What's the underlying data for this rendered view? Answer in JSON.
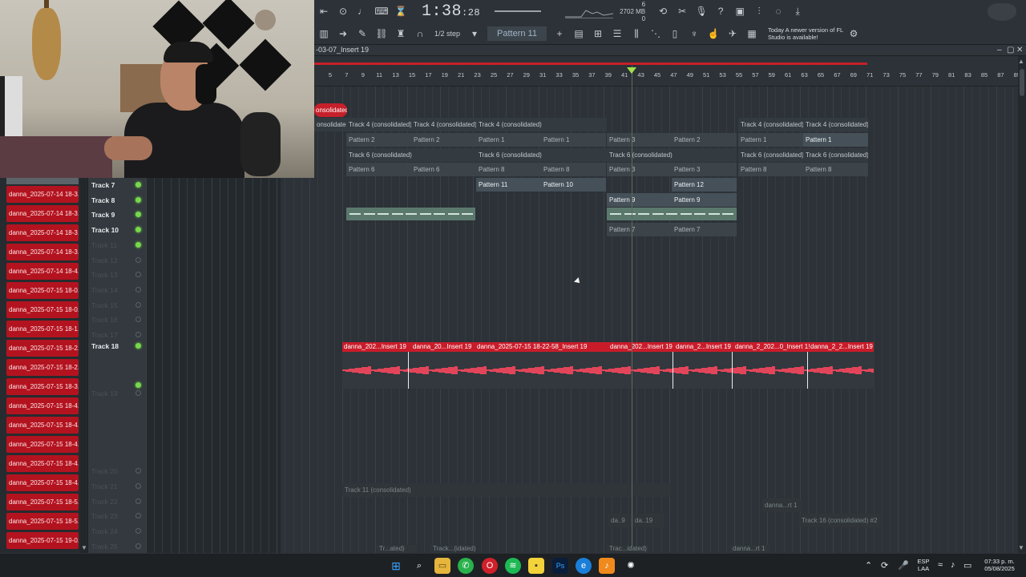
{
  "toolbar": {
    "time_main": "1:38",
    "time_small": ":28",
    "cpu_line1": "6",
    "cpu_line2": "2702 MB",
    "cpu_line3": "0",
    "snap_label": "1/2 step",
    "pattern_label": "Pattern 11",
    "notice_prefix": "Today",
    "notice_text": "A newer version of FL Studio is available!",
    "icons": [
      "record-icon",
      "metronome-icon",
      "typing-keyboard-icon",
      "wait-icon",
      "countdown-icon",
      "undo-icon",
      "cut-icon",
      "info-icon",
      "save-icon",
      "mixer-icon",
      "browser-icon",
      "download-icon"
    ]
  },
  "playlist": {
    "title": "-03-07_Insert 19",
    "timeline_numbers": [
      "5",
      "7",
      "9",
      "11",
      "13",
      "15",
      "17",
      "19",
      "21",
      "23",
      "25",
      "27",
      "29",
      "31",
      "33",
      "35",
      "37",
      "39",
      "41",
      "43",
      "45",
      "47",
      "49",
      "51",
      "53",
      "55",
      "57",
      "59",
      "61",
      "63",
      "65",
      "67",
      "69",
      "71",
      "73",
      "75",
      "77",
      "79",
      "81",
      "83",
      "85",
      "87",
      "89"
    ]
  },
  "browser": {
    "top_item": "",
    "items": [
      "danna_2025-07-14 18-3...",
      "danna_2025-07-14 18-3...",
      "danna_2025-07-14 18-3...",
      "danna_2025-07-14 18-3...",
      "danna_2025-07-14 18-4...",
      "danna_2025-07-15 18-0...",
      "danna_2025-07-15 18-0...",
      "danna_2025-07-15 18-1...",
      "danna_2025-07-15 18-2...",
      "danna_2025-07-15 18-2...",
      "danna_2025-07-15 18-3...",
      "danna_2025-07-15 18-4...",
      "danna_2025-07-15 18-4...",
      "danna_2025-07-15 18-4...",
      "danna_2025-07-15 18-4...",
      "danna_2025-07-15 18-4...",
      "danna_2025-07-15 18-5...",
      "danna_2025-07-15 18-5...",
      "danna_2025-07-15 19-0..."
    ]
  },
  "tracks": [
    {
      "name": "Track 7",
      "state": "active"
    },
    {
      "name": "Track 8",
      "state": "active"
    },
    {
      "name": "Track 9",
      "state": "active"
    },
    {
      "name": "Track 10",
      "state": "active"
    },
    {
      "name": "Track 11",
      "state": "muted-on"
    },
    {
      "name": "Track 12",
      "state": "muted"
    },
    {
      "name": "Track 13",
      "state": "muted"
    },
    {
      "name": "Track 14",
      "state": "muted"
    },
    {
      "name": "Track 15",
      "state": "muted"
    },
    {
      "name": "Track 16",
      "state": "muted"
    },
    {
      "name": "Track 17",
      "state": "muted"
    },
    {
      "name": "Track 18",
      "state": "active"
    },
    {
      "name": "Track 19",
      "state": "muted"
    },
    {
      "name": "Track 20",
      "state": "muted"
    },
    {
      "name": "Track 21",
      "state": "muted"
    },
    {
      "name": "Track 22",
      "state": "muted"
    },
    {
      "name": "Track 23",
      "state": "muted"
    },
    {
      "name": "Track 24",
      "state": "muted"
    },
    {
      "name": "Track 25",
      "state": "muted"
    }
  ],
  "clips": {
    "red_tag": "onsolidated)",
    "row1": [
      "onsolidated)",
      "Track 4 (consolidated)",
      "Track 4 (consolidated)",
      "Track 4 (consolidated)",
      "Track 4 (consolidated)",
      "Track 4 (consolidated)"
    ],
    "row2": [
      "Pattern 2",
      "Pattern 2",
      "Pattern 1",
      "Pattern 1",
      "Pattern 3",
      "Pattern 2",
      "Pattern 1",
      "Pattern 1"
    ],
    "row3": [
      "Track 6 (consolidated)",
      "Track 6 (consolidated)",
      "Track 6 (consolidated)",
      "Track 6 (consolidated)",
      "Track 6 (consolidated)"
    ],
    "row4": [
      "Pattern 6",
      "Pattern 6",
      "Pattern 8",
      "Pattern 8",
      "Pattern 3",
      "Pattern 3",
      "Pattern 8",
      "Pattern 8"
    ],
    "row5": [
      "Pattern 11",
      "Pattern 10",
      "Pattern 12"
    ],
    "row6": [
      "Pattern 9",
      "Pattern 9"
    ],
    "row8": [
      "Pattern 7",
      "Pattern 7"
    ],
    "audio": [
      "danna_202...Insert 19",
      "danna_20...Insert 19",
      "danna_2025-07-15 18-22-58_Insert 19",
      "danna_202...Insert 19",
      "danna_2...Insert 19",
      "danna_2_202...0_Insert 1!",
      "danna_2_2...Insert 19"
    ],
    "track21": "Track 11 (consolidated)",
    "track22": "danna...rt 1",
    "track23a": "da..9",
    "track23b": "da..19",
    "track23c": "Track 16 (consolidated) #2",
    "track24a": "Tr...ated)",
    "track24b": "Track...(idated)",
    "track24c": "Trac...idated)",
    "track24d": "danna...rt 1"
  },
  "taskbar": {
    "lang1": "ESP",
    "lang2": "LAA",
    "time": "07:33 p. m.",
    "date": "05/08/2025",
    "apps": [
      "windows-start-icon",
      "search-icon",
      "file-explorer-icon",
      "whatsapp-icon",
      "opera-icon",
      "spotify-icon",
      "sticky-notes-icon",
      "photoshop-icon",
      "edge-icon",
      "fl-studio-icon",
      "chatgpt-icon"
    ]
  },
  "colors": {
    "accent_red": "#c6202a",
    "led_green": "#76d94a",
    "playhead_green": "#a2e04d",
    "pattern_green": "#5b786c"
  }
}
